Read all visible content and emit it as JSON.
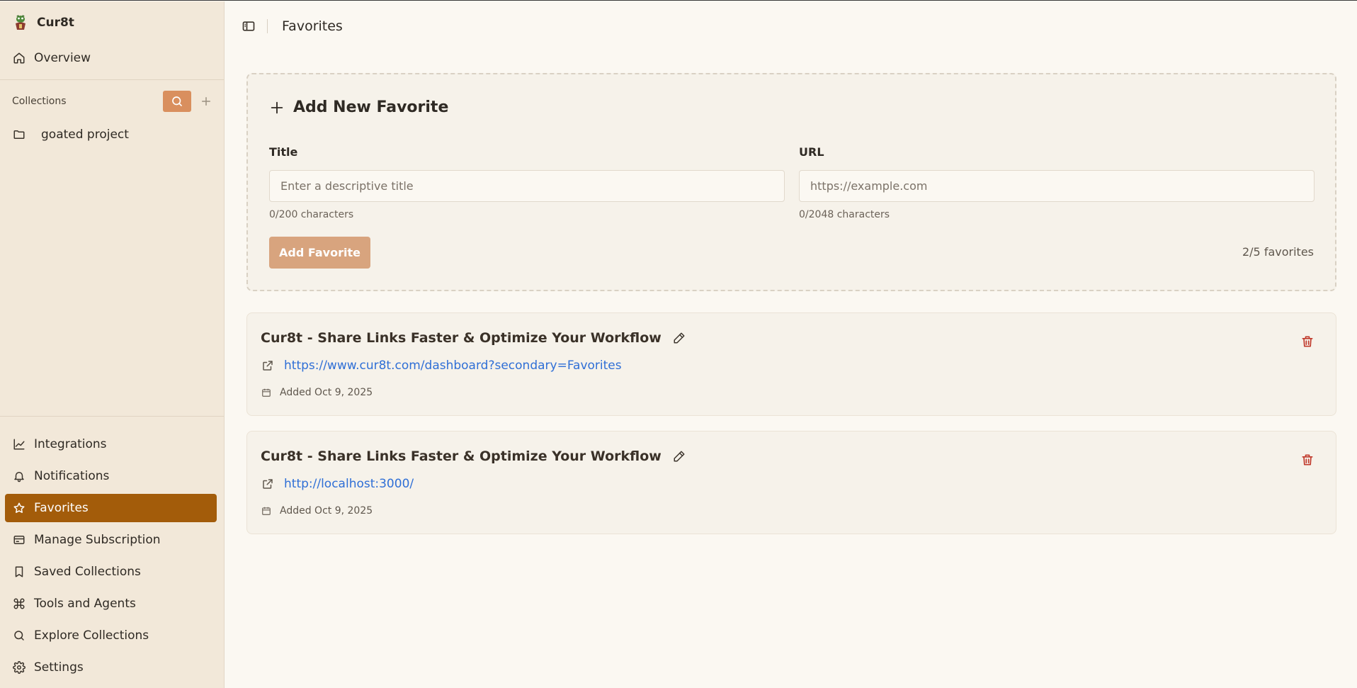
{
  "app": {
    "name": "Cur8t"
  },
  "sidebar": {
    "overview_label": "Overview",
    "collections_label": "Collections",
    "collections": [
      {
        "label": "goated project"
      }
    ],
    "bottom_items": [
      {
        "label": "Integrations",
        "icon": "chart-line-icon"
      },
      {
        "label": "Notifications",
        "icon": "bell-icon"
      },
      {
        "label": "Favorites",
        "icon": "star-icon",
        "active": true
      },
      {
        "label": "Manage Subscription",
        "icon": "credit-card-icon"
      },
      {
        "label": "Saved Collections",
        "icon": "bookmark-icon"
      },
      {
        "label": "Tools and Agents",
        "icon": "command-icon"
      },
      {
        "label": "Explore Collections",
        "icon": "search-icon"
      },
      {
        "label": "Settings",
        "icon": "gear-icon"
      }
    ]
  },
  "header": {
    "title": "Favorites"
  },
  "add_form": {
    "heading": "Add New Favorite",
    "title_label": "Title",
    "title_placeholder": "Enter a descriptive title",
    "title_value": "",
    "title_count": "0/200 characters",
    "url_label": "URL",
    "url_placeholder": "https://example.com",
    "url_value": "",
    "url_count": "0/2048 characters",
    "submit_label": "Add Favorite",
    "favorites_count": "2/5 favorites"
  },
  "favorites": [
    {
      "title": "Cur8t - Share Links Faster & Optimize Your Workflow",
      "url": "https://www.cur8t.com/dashboard?secondary=Favorites",
      "added": "Added Oct 9, 2025"
    },
    {
      "title": "Cur8t - Share Links Faster & Optimize Your Workflow",
      "url": "http://localhost:3000/",
      "added": "Added Oct 9, 2025"
    }
  ],
  "colors": {
    "sidebar_bg": "#f2e8d9",
    "active_nav": "#a35c0a",
    "accent_button": "#d98f5e",
    "submit_button": "#d8a47e",
    "link": "#2f6fd6",
    "delete": "#c0392b"
  }
}
